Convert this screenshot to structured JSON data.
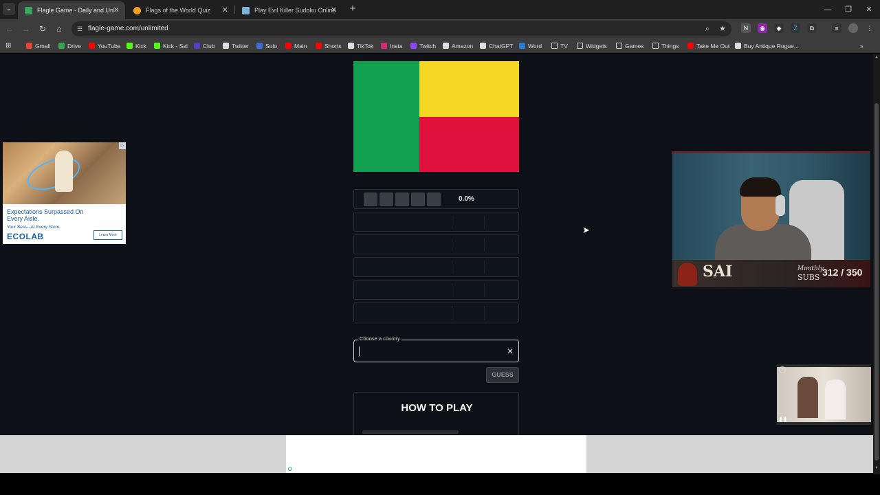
{
  "browser": {
    "tabs": [
      {
        "title": "Flagle Game - Daily and Unlimited",
        "active": true,
        "favicon_color": "#3ba55c"
      },
      {
        "title": "Flags of the World Quiz",
        "active": false,
        "favicon_color": "#f0a020"
      },
      {
        "title": "Play Evil Killer Sudoku Online",
        "active": false,
        "favicon_color": "#7fb3d5"
      }
    ],
    "url": "flagle-game.com/unlimited",
    "bookmarks": [
      {
        "label": "Gmail",
        "icon": "gmail-icon",
        "color": "#ea4335"
      },
      {
        "label": "Drive",
        "icon": "drive-icon",
        "color": "#34a853"
      },
      {
        "label": "YouTube",
        "icon": "youtube-icon",
        "color": "#ff0000"
      },
      {
        "label": "Kick",
        "icon": "kick-icon",
        "color": "#53fc18"
      },
      {
        "label": "Kick - Sai",
        "icon": "kick-icon",
        "color": "#53fc18"
      },
      {
        "label": "Club",
        "icon": "club-icon",
        "color": "#5b3cc4"
      },
      {
        "label": "Twitter",
        "icon": "x-icon",
        "color": "#e0e0e0"
      },
      {
        "label": "Solo",
        "icon": "solo-icon",
        "color": "#3d6fd8"
      },
      {
        "label": "Main",
        "icon": "youtube-icon",
        "color": "#ff0000"
      },
      {
        "label": "Shorts",
        "icon": "youtube-icon",
        "color": "#ff0000"
      },
      {
        "label": "TikTok",
        "icon": "tiktok-icon",
        "color": "#e0e0e0"
      },
      {
        "label": "Insta",
        "icon": "instagram-icon",
        "color": "#d62976"
      },
      {
        "label": "Twitch",
        "icon": "twitch-icon",
        "color": "#9146ff"
      },
      {
        "label": "Amazon",
        "icon": "amazon-icon",
        "color": "#e0e0e0"
      },
      {
        "label": "ChatGPT",
        "icon": "chatgpt-icon",
        "color": "#e0e0e0"
      },
      {
        "label": "Word",
        "icon": "word-icon",
        "color": "#2b7cd3"
      },
      {
        "label": "TV",
        "icon": "folder-icon",
        "color": "#cfcfcf"
      },
      {
        "label": "Widgets",
        "icon": "folder-icon",
        "color": "#cfcfcf"
      },
      {
        "label": "Games",
        "icon": "folder-icon",
        "color": "#cfcfcf"
      },
      {
        "label": "Things",
        "icon": "folder-icon",
        "color": "#cfcfcf"
      },
      {
        "label": "Take Me Out",
        "icon": "youtube-icon",
        "color": "#ff0000"
      },
      {
        "label": "Buy Antique Rogue...",
        "icon": "notion-icon",
        "color": "#e0e0e0"
      }
    ]
  },
  "game": {
    "flag": {
      "colors": {
        "green": "#10a050",
        "yellow": "#f5d824",
        "red": "#e0123b"
      }
    },
    "progress_percent": "0.0%",
    "guess_rows": 5,
    "input_label": "Choose a country",
    "input_value": "",
    "guess_button": "GUESS",
    "how_to_play_title": "HOW TO PLAY"
  },
  "ads": {
    "left": {
      "headline": "Expectations Surpassed On Every Aisle.",
      "subline": "Your Best—At Every Store.",
      "brand": "ECOLAB",
      "cta": "Learn More"
    }
  },
  "overlay": {
    "streamer_name": "SAI",
    "monthly_label": "Monthly",
    "subs_label": "SUBS",
    "subs_count": "312 / 350"
  }
}
